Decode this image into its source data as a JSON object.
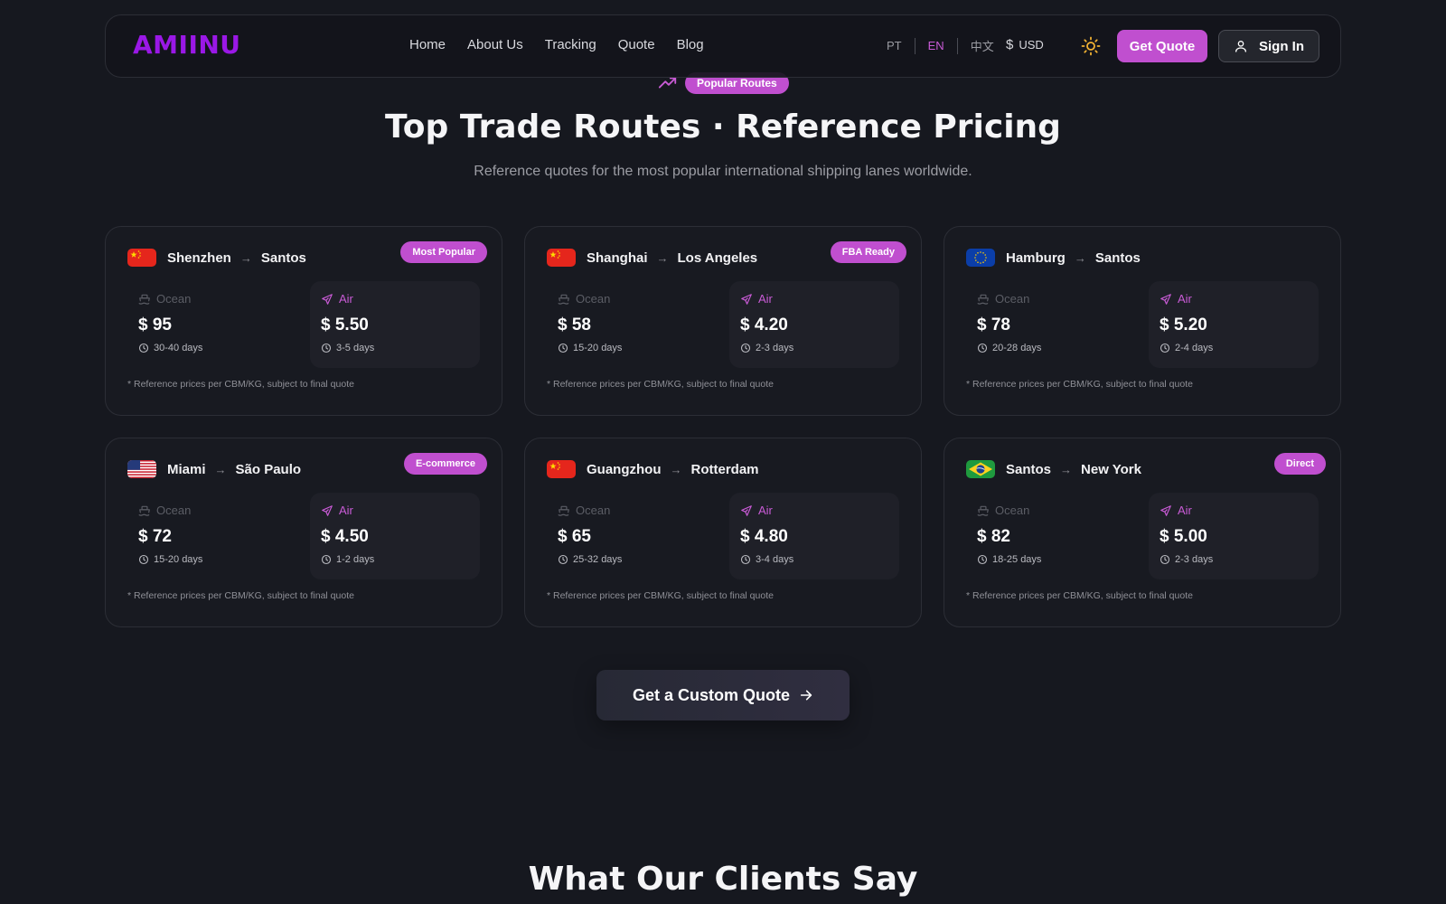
{
  "nav": {
    "logo": "AMIINU",
    "links": [
      "Home",
      "About Us",
      "Tracking",
      "Quote",
      "Blog"
    ],
    "languages": [
      {
        "label": "PT",
        "active": false
      },
      {
        "label": "EN",
        "active": true
      },
      {
        "label": "中文",
        "active": false
      }
    ],
    "currency": "USD",
    "get_quote": "Get Quote",
    "sign_in": "Sign In"
  },
  "header": {
    "badge": "Popular Routes",
    "title": "Top Trade Routes · Reference Pricing",
    "subtitle": "Reference quotes for the most popular international shipping lanes worldwide."
  },
  "labels": {
    "ocean": "Ocean",
    "air": "Air",
    "note": "* Reference prices per CBM/KG, subject to final quote"
  },
  "routes": [
    {
      "flag": "cn",
      "from": "Shenzhen",
      "to": "Santos",
      "badge": "Most Popular",
      "ocean_price": "$ 95",
      "ocean_days": "30-40 days",
      "air_price": "$ 5.50",
      "air_days": "3-5 days"
    },
    {
      "flag": "cn",
      "from": "Shanghai",
      "to": "Los Angeles",
      "badge": "FBA Ready",
      "ocean_price": "$ 58",
      "ocean_days": "15-20 days",
      "air_price": "$ 4.20",
      "air_days": "2-3 days"
    },
    {
      "flag": "eu",
      "from": "Hamburg",
      "to": "Santos",
      "badge": "",
      "ocean_price": "$ 78",
      "ocean_days": "20-28 days",
      "air_price": "$ 5.20",
      "air_days": "2-4 days"
    },
    {
      "flag": "us",
      "from": "Miami",
      "to": "São Paulo",
      "badge": "E-commerce",
      "ocean_price": "$ 72",
      "ocean_days": "15-20 days",
      "air_price": "$ 4.50",
      "air_days": "1-2 days"
    },
    {
      "flag": "cn",
      "from": "Guangzhou",
      "to": "Rotterdam",
      "badge": "",
      "ocean_price": "$ 65",
      "ocean_days": "25-32 days",
      "air_price": "$ 4.80",
      "air_days": "3-4 days"
    },
    {
      "flag": "br",
      "from": "Santos",
      "to": "New York",
      "badge": "Direct",
      "ocean_price": "$ 82",
      "ocean_days": "18-25 days",
      "air_price": "$ 5.00",
      "air_days": "2-3 days"
    }
  ],
  "cta": {
    "label": "Get a Custom Quote"
  },
  "clients": {
    "title": "What Our Clients Say"
  },
  "colors": {
    "accent": "#c04fcf",
    "logo": "#9a18e6",
    "background": "#16181f",
    "card_border": "#2c2e36"
  }
}
